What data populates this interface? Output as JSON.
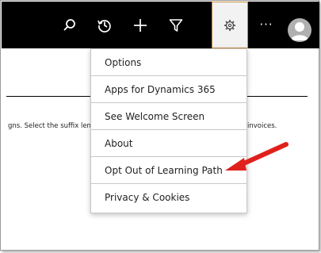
{
  "topbar": {
    "icons": [
      "search-icon",
      "history-icon",
      "plus-icon",
      "filter-icon",
      "gear-icon",
      "avatar-icon"
    ],
    "more_label": "···"
  },
  "background": {
    "text_left": "gns. Select the suffix len",
    "text_right": "invoices."
  },
  "menu": {
    "items": [
      {
        "label": "Options"
      },
      {
        "label": "Apps for Dynamics 365"
      },
      {
        "label": "See Welcome Screen"
      },
      {
        "label": "About"
      },
      {
        "label": "Opt Out of Learning Path"
      },
      {
        "label": "Privacy & Cookies"
      }
    ]
  },
  "annotation": {
    "arrow_color": "#e0201b",
    "points_to": "Opt Out of Learning Path"
  },
  "colors": {
    "topbar": "#000000",
    "gear_border": "#c58a3a",
    "menu_border": "#c8c8c8"
  }
}
